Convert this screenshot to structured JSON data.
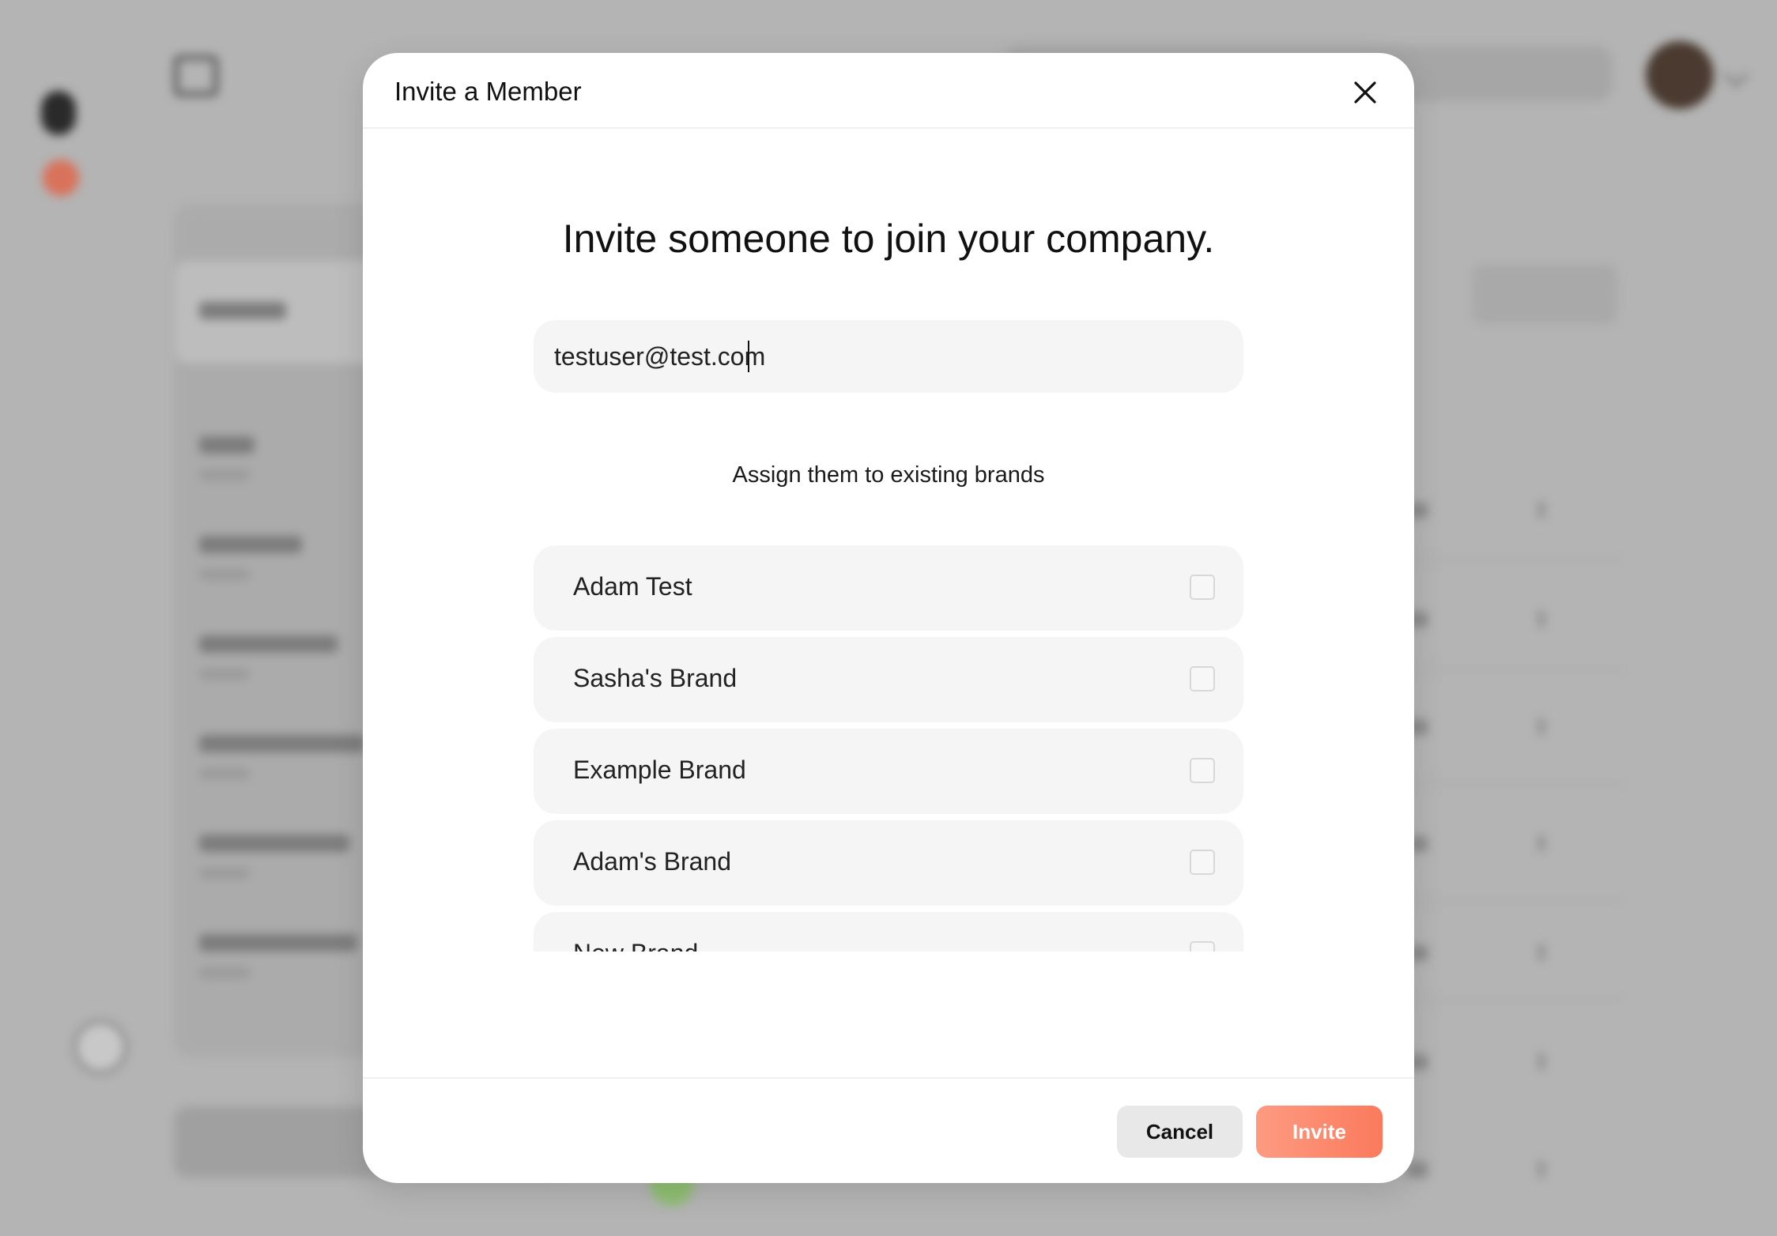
{
  "modal": {
    "title": "Invite a Member",
    "headline": "Invite someone to join your company.",
    "email_value": "testuser@test.com",
    "assign_label": "Assign them to existing brands",
    "brands": [
      {
        "label": "Adam Test",
        "checked": false
      },
      {
        "label": "Sasha's Brand",
        "checked": false
      },
      {
        "label": "Example Brand",
        "checked": false
      },
      {
        "label": "Adam's Brand",
        "checked": false
      },
      {
        "label": "New Brand",
        "checked": false
      }
    ],
    "cancel_label": "Cancel",
    "invite_label": "Invite",
    "close_icon": "close-icon"
  },
  "colors": {
    "invite_gradient_start": "#fc9b82",
    "invite_gradient_end": "#fb7a5c",
    "overlay": "#b4b4b4"
  }
}
